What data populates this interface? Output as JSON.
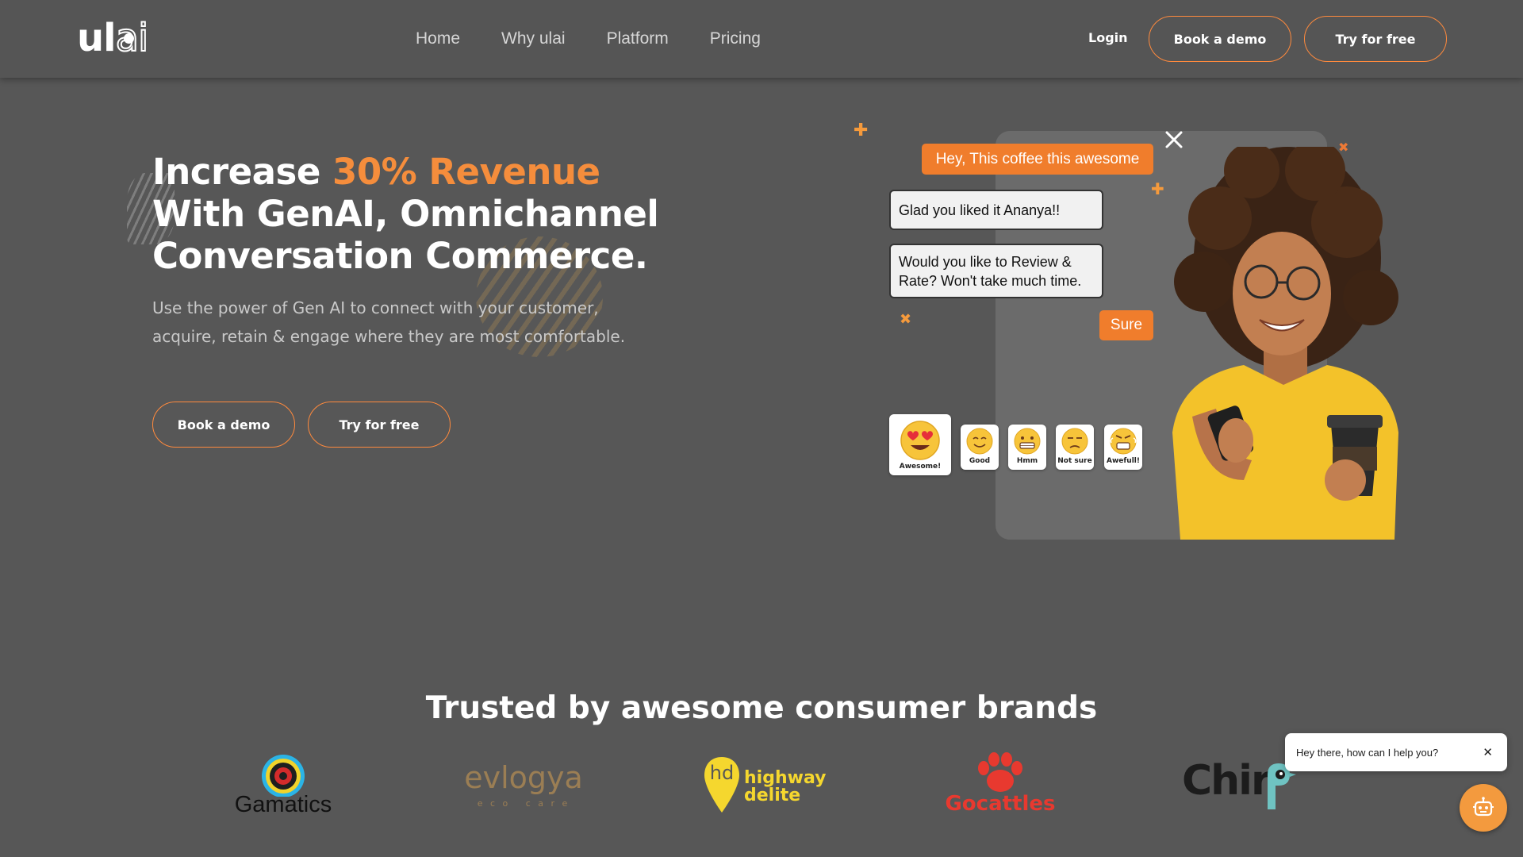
{
  "header": {
    "logo": {
      "part1": "ul",
      "part2": "ai"
    },
    "nav": [
      "Home",
      "Why ulai",
      "Platform",
      "Pricing"
    ],
    "login": "Login",
    "book_demo": "Book a demo",
    "try_free": "Try for free"
  },
  "hero": {
    "title_pre": "Increase ",
    "title_accent": "30% Revenue",
    "title_line2": "With GenAI, Omnichannel",
    "title_line3": "Conversation Commerce.",
    "subtitle": "Use the power of Gen AI to connect with your customer, acquire, retain & engage where they are most comfortable.",
    "book_demo": "Book a demo",
    "try_free": "Try for free"
  },
  "chat_demo": {
    "customer_msg": "Hey, This coffee this awesome",
    "bot_msg1": "Glad you liked it Ananya!!",
    "bot_msg2": "Would you like to Review & Rate? Won't take much time.",
    "customer_reply": "Sure",
    "ratings": [
      {
        "label": "Awesome!",
        "icon": "heart-eyes-emoji-icon"
      },
      {
        "label": "Good",
        "icon": "smiling-emoji-icon"
      },
      {
        "label": "Hmm",
        "icon": "grimace-emoji-icon"
      },
      {
        "label": "Not sure",
        "icon": "unamused-emoji-icon"
      },
      {
        "label": "Awefull!",
        "icon": "angry-emoji-icon"
      }
    ]
  },
  "trusted": {
    "title": "Trusted by awesome consumer brands",
    "brands": {
      "gamatics": "Gamatics",
      "evlogya": "evlogya",
      "evlogya_sub": "e c o   c a r e",
      "highway_logo": "hd",
      "highway_1": "highway",
      "highway_2": "delite",
      "gocattles": "Gocattles",
      "chirp": "Chir"
    }
  },
  "chat_widget": {
    "prompt": "Hey there, how can I help you?",
    "close": "✕"
  },
  "colors": {
    "background": "#575757",
    "accent": "#f58d3c",
    "bubble_orange": "#f07d2c"
  }
}
